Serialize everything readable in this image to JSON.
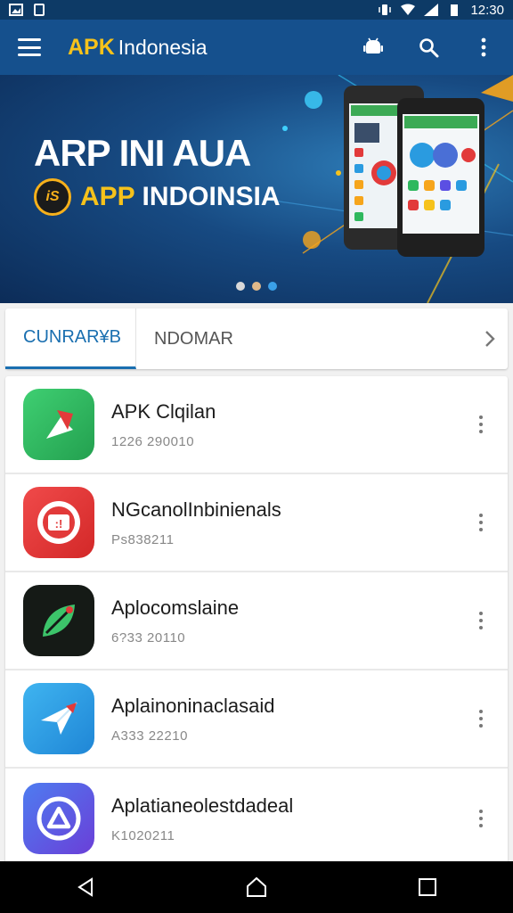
{
  "status": {
    "time": "12:30"
  },
  "appbar": {
    "brand_bold": "APK",
    "brand_rest": "Indonesia",
    "icons": [
      "menu-icon",
      "android-icon",
      "search-icon",
      "more-vert-icon"
    ]
  },
  "banner": {
    "title": "ARP INI AUA",
    "logo_text": "iS",
    "subtitle_highlight": "APP",
    "subtitle_rest": "INDOINSIA",
    "dots": 3,
    "active_dot": 1
  },
  "tabs": [
    {
      "label": "CUNRAR¥B"
    },
    {
      "label": "NDOMAR"
    }
  ],
  "apps": [
    {
      "name": "APK Clqilan",
      "meta": "1226 290010",
      "color": "#2fb85e",
      "icon": "pin-icon"
    },
    {
      "name": "NGcanolInbinienals",
      "meta": "Ps838211",
      "color": "#e23a3a",
      "icon": "screen-icon"
    },
    {
      "name": "Aplocomslaine",
      "meta": "6?33 20110",
      "color": "#1a1a1a",
      "icon": "leaf-icon"
    },
    {
      "name": "Aplainoninaclasaid",
      "meta": "A333 22210",
      "color": "#2a9be0",
      "icon": "paper-plane-icon"
    },
    {
      "name": "Aplatianeolestdadeal",
      "meta": "K1020211",
      "color": "#5b4fe3",
      "icon": "app-store-icon"
    }
  ],
  "colors": {
    "appbar": "#15508d",
    "accent": "#1a6fb0",
    "brand_yellow": "#f6c21b"
  }
}
